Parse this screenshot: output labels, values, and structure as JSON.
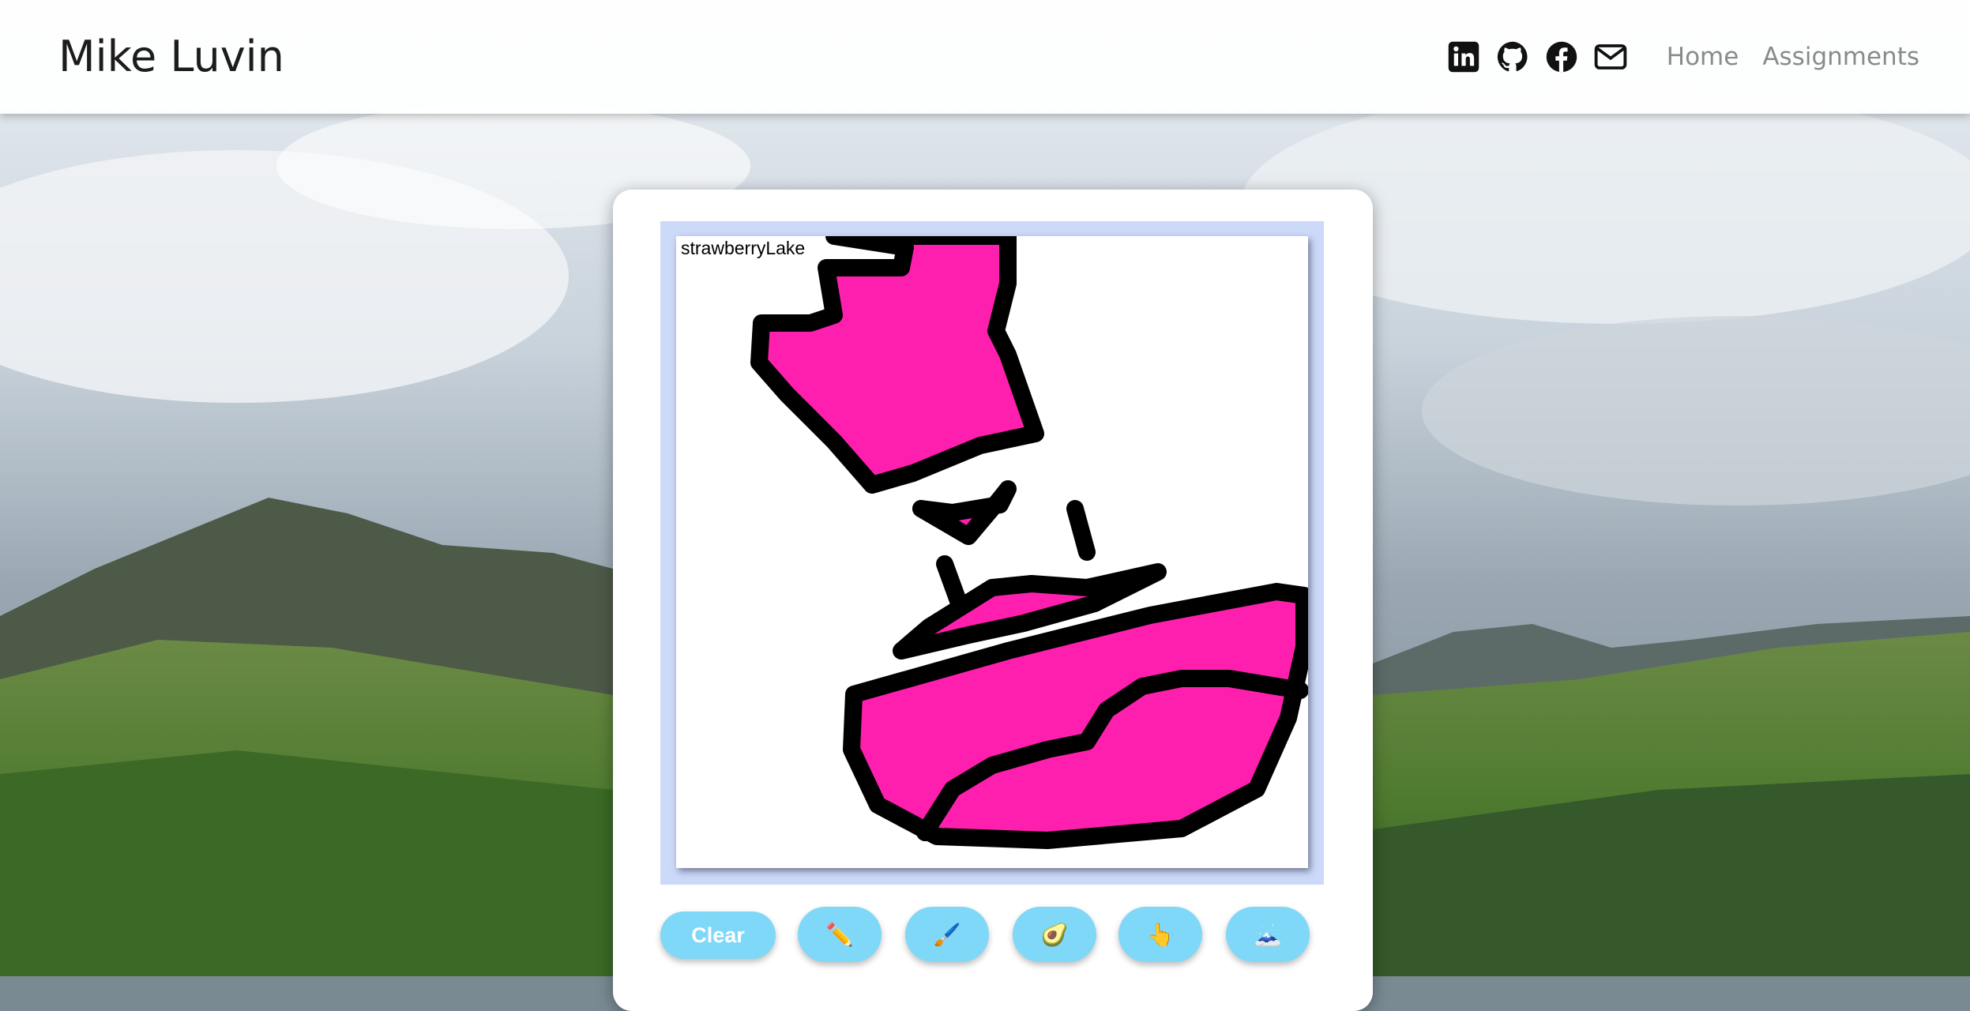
{
  "header": {
    "brand": "Mike Luvin",
    "social_icons": [
      "linkedin-icon",
      "github-icon",
      "facebook-icon",
      "mail-icon"
    ],
    "nav_links": [
      "Home",
      "Assignments"
    ]
  },
  "canvas": {
    "label": "strawberryLake",
    "stroke_color": "#000000",
    "fill_color": "#ff1fae",
    "frame_color": "#ccd9f8"
  },
  "tools": {
    "clear_label": "Clear",
    "buttons": [
      {
        "icon": "pencil-icon",
        "glyph": "✏️"
      },
      {
        "icon": "brush-icon",
        "glyph": "🖌️"
      },
      {
        "icon": "avocado-icon",
        "glyph": "🥑"
      },
      {
        "icon": "pointer-hand-icon",
        "glyph": "👆"
      },
      {
        "icon": "mountain-icon",
        "glyph": "🗻"
      }
    ],
    "button_color": "#7fd8f7"
  }
}
